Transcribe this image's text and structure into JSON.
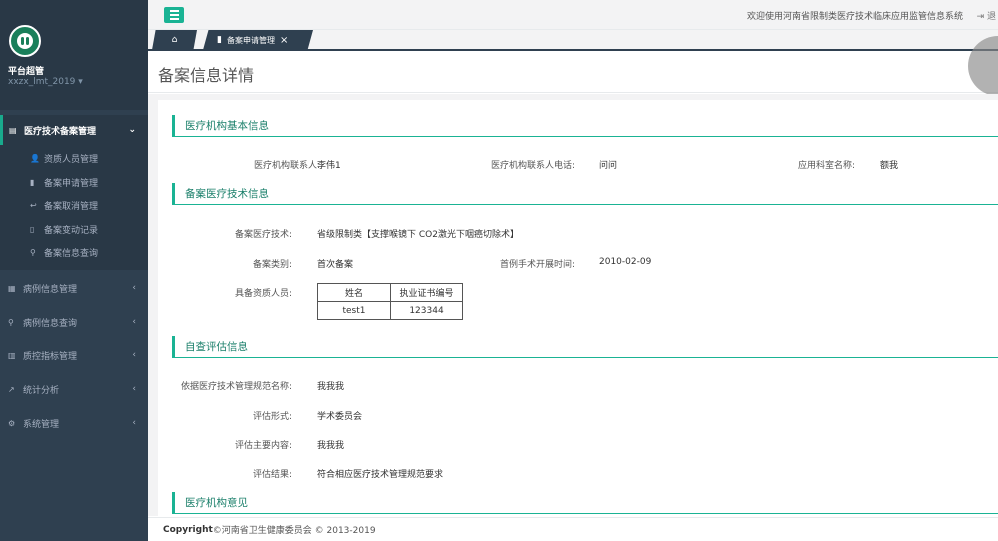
{
  "sidebar": {
    "user_name": "平台超管",
    "account": "xxzx_lmt_2019",
    "active_menu": {
      "label": "医疗技术备案管理",
      "icon": "book-icon"
    },
    "submenu": [
      {
        "label": "资质人员管理",
        "icon": "user-icon"
      },
      {
        "label": "备案申请管理",
        "icon": "bookmark-icon"
      },
      {
        "label": "备案取消管理",
        "icon": "reply-icon"
      },
      {
        "label": "备案变动记录",
        "icon": "file-icon"
      },
      {
        "label": "备案信息查询",
        "icon": "search-icon"
      }
    ],
    "menus": [
      {
        "label": "病例信息管理",
        "icon": "grid-icon"
      },
      {
        "label": "病例信息查询",
        "icon": "search-icon"
      },
      {
        "label": "质控指标管理",
        "icon": "bar-chart-icon"
      },
      {
        "label": "统计分析",
        "icon": "line-chart-icon"
      },
      {
        "label": "系统管理",
        "icon": "gear-icon"
      }
    ]
  },
  "topbar": {
    "welcome": "欢迎使用河南省限制类医疗技术临床应用监管信息系统",
    "logout": "退"
  },
  "tabs": {
    "active_label": "备案申请管理"
  },
  "page": {
    "title": "备案信息详情"
  },
  "sections": {
    "basic": {
      "title": "医疗机构基本信息",
      "contact_label": "医疗机构联系人:",
      "contact_value": "李伟1",
      "phone_label": "医疗机构联系人电话:",
      "phone_value": "问问",
      "dept_label": "应用科室名称:",
      "dept_value": "额我"
    },
    "tech": {
      "title": "备案医疗技术信息",
      "tech_label": "备案医疗技术:",
      "tech_value": "省级限制类【支撑喉镜下 CO2激光下咽癌切除术】",
      "type_label": "备案类别:",
      "type_value": "首次备案",
      "date_label": "首例手术开展时间:",
      "date_value": "2010-02-09",
      "staff_label": "具备资质人员:",
      "table_headers": [
        "姓名",
        "执业证书编号"
      ],
      "table_rows": [
        [
          "test1",
          "123344"
        ]
      ]
    },
    "eval": {
      "title": "自查评估信息",
      "norm_label": "依据医疗技术管理规范名称:",
      "norm_value": "我我我",
      "form_label": "评估形式:",
      "form_value": "学术委员会",
      "content_label": "评估主要内容:",
      "content_value": "我我我",
      "result_label": "评估结果:",
      "result_value": "符合相应医疗技术管理规范要求"
    },
    "opinion": {
      "title": "医疗机构意见"
    }
  },
  "footer": {
    "copyright_bold": "Copyright",
    "copyright_text": "©河南省卫生健康委员会 © 2013-2019"
  }
}
